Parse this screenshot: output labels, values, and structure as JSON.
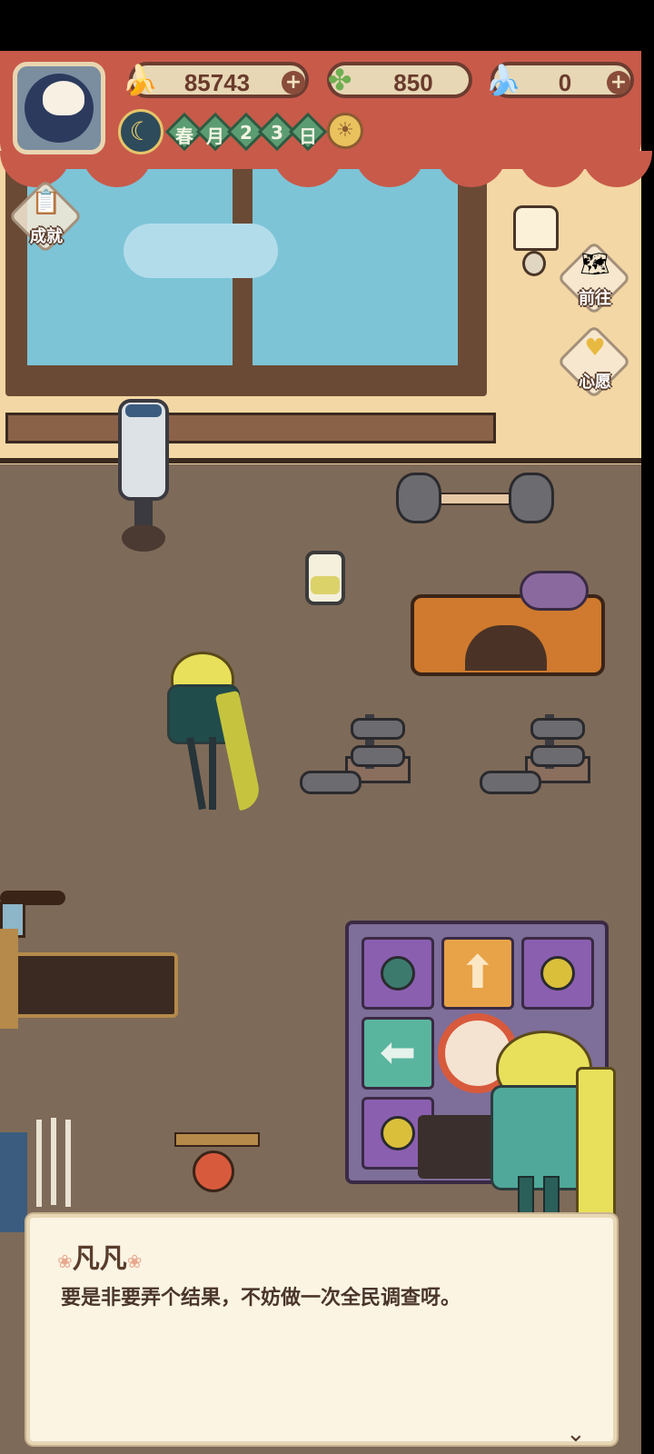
{
  "hud": {
    "resources": [
      {
        "name": "banana",
        "icon": "banana-icon",
        "value": "85743",
        "has_plus": true
      },
      {
        "name": "clover",
        "icon": "clover-icon",
        "value": "850",
        "has_plus": false
      },
      {
        "name": "blue-banana",
        "icon": "blue-banana-icon",
        "value": "0",
        "has_plus": true
      }
    ],
    "date": {
      "season": "春",
      "month_label": "月",
      "day_digit_1": "2",
      "day_digit_2": "3",
      "day_label": "日"
    }
  },
  "side_buttons": {
    "achievements": "成就",
    "goto": "前往",
    "wish": "心愿"
  },
  "dialog": {
    "speaker": "凡凡",
    "text": "要是非要弄个结果，不妨做一次全民调查呀。"
  },
  "colors": {
    "curtain": "#c85a4a",
    "wall": "#f3d7a4",
    "floor": "#7e6a58",
    "dialog_bg": "#fcf4e3",
    "text_brown": "#5a3d2c"
  }
}
